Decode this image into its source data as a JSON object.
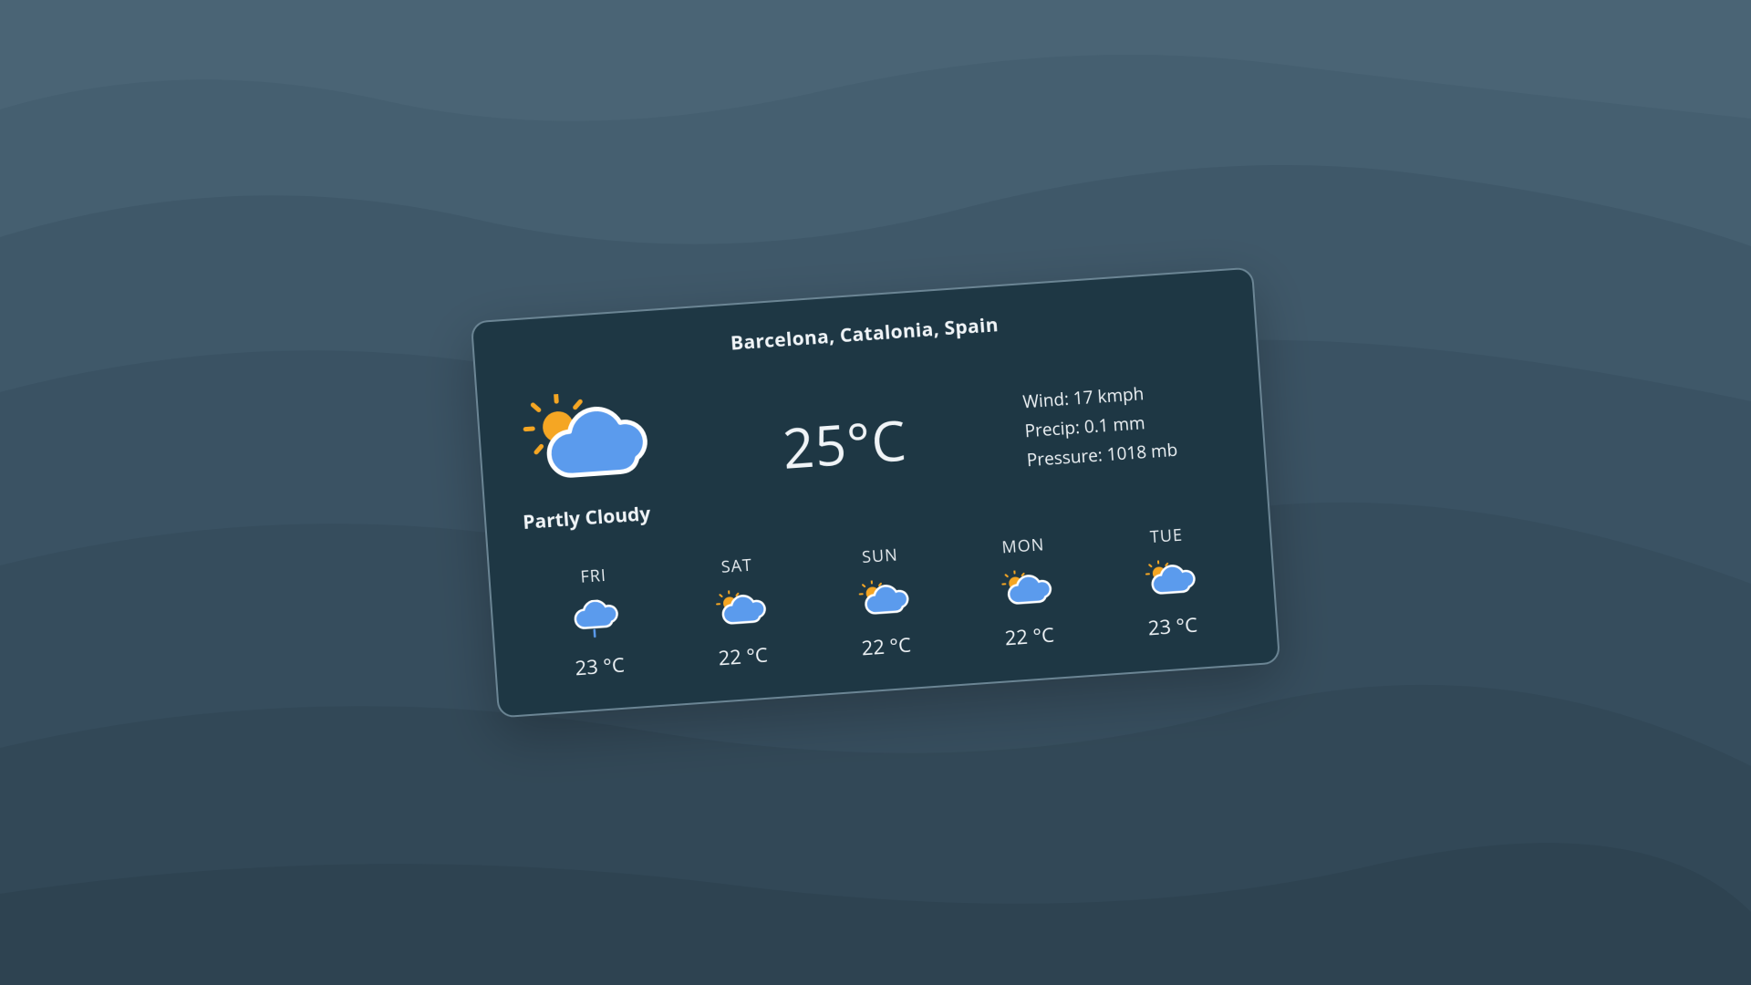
{
  "location": "Barcelona, Catalonia, Spain",
  "current": {
    "condition": "Partly Cloudy",
    "temperature": "25°C",
    "wind": "Wind: 17 kmph",
    "precip": "Precip: 0.1 mm",
    "pressure": "Pressure: 1018 mb",
    "icon": "partly-cloudy"
  },
  "forecast": [
    {
      "day": "FRI",
      "icon": "light-rain",
      "temp": "23 °C"
    },
    {
      "day": "SAT",
      "icon": "partly-cloudy",
      "temp": "22 °C"
    },
    {
      "day": "SUN",
      "icon": "partly-cloudy",
      "temp": "22 °C"
    },
    {
      "day": "MON",
      "icon": "partly-cloudy",
      "temp": "22 °C"
    },
    {
      "day": "TUE",
      "icon": "partly-cloudy",
      "temp": "23 °C"
    }
  ],
  "colors": {
    "card_bg": "#1e3744",
    "card_border": "#6b8594",
    "sun": "#f5a623",
    "cloud": "#5b9bed",
    "cloud_stroke": "#ffffff",
    "text": "#f0f4f7"
  }
}
